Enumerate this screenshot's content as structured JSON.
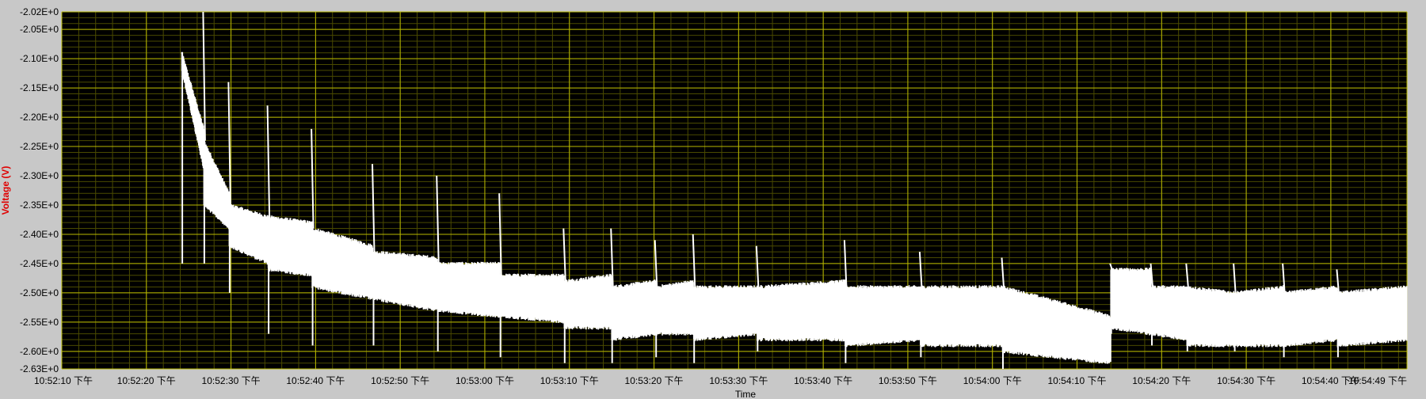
{
  "chart_data": {
    "type": "line",
    "xlabel": "Time",
    "ylabel": "Voltage (V)",
    "ylim": [
      -2.63,
      -2.02
    ],
    "xlim": [
      "10:52:10 下午",
      "10:54:49 下午"
    ],
    "grid": true,
    "background_color": "#000000",
    "grid_color": "#b8b800",
    "minor_grid_color": "#4a4a00",
    "series_color": "#ffffff",
    "y_ticks": [
      "-2.02E+0",
      "-2.05E+0",
      "-2.10E+0",
      "-2.15E+0",
      "-2.20E+0",
      "-2.25E+0",
      "-2.30E+0",
      "-2.35E+0",
      "-2.40E+0",
      "-2.45E+0",
      "-2.50E+0",
      "-2.55E+0",
      "-2.60E+0",
      "-2.63E+0"
    ],
    "y_tick_values": [
      -2.02,
      -2.05,
      -2.1,
      -2.15,
      -2.2,
      -2.25,
      -2.3,
      -2.35,
      -2.4,
      -2.45,
      -2.5,
      -2.55,
      -2.6,
      -2.63
    ],
    "x_ticks": [
      "10:52:10 下午",
      "10:52:20 下午",
      "10:52:30 下午",
      "10:52:40 下午",
      "10:52:50 下午",
      "10:53:00 下午",
      "10:53:10 下午",
      "10:53:20 下午",
      "10:53:30 下午",
      "10:53:40 下午",
      "10:53:50 下午",
      "10:54:00 下午",
      "10:54:10 下午",
      "10:54:20 下午",
      "10:54:30 下午",
      "10:54:40 下午",
      "10:54:49 下午"
    ],
    "x_tick_seconds": [
      0,
      10,
      20,
      30,
      40,
      50,
      60,
      70,
      80,
      90,
      100,
      110,
      120,
      130,
      140,
      150,
      159
    ],
    "series": [
      {
        "segments": [
          {
            "t": [
              14.2,
              16.8
            ],
            "low_start": -2.12,
            "low_end": -2.29,
            "high_start": -2.09,
            "high_end": -2.22,
            "spike_low": -2.45
          },
          {
            "t": [
              16.8,
              19.8
            ],
            "low_start": -2.35,
            "low_end": -2.39,
            "high_start": -2.24,
            "high_end": -2.33,
            "spike_high": -2.02,
            "spike_low": -2.45
          },
          {
            "t": [
              19.8,
              24.4
            ],
            "low_start": -2.42,
            "low_end": -2.45,
            "high_start": -2.35,
            "high_end": -2.37,
            "spike_high": -2.14,
            "spike_low": -2.5
          },
          {
            "t": [
              24.4,
              29.6
            ],
            "low_start": -2.46,
            "low_end": -2.47,
            "high_start": -2.37,
            "high_end": -2.38,
            "spike_high": -2.18,
            "spike_low": -2.57
          },
          {
            "t": [
              29.6,
              36.8
            ],
            "low_start": -2.49,
            "low_end": -2.51,
            "high_start": -2.39,
            "high_end": -2.42,
            "spike_high": -2.22,
            "spike_low": -2.59
          },
          {
            "t": [
              36.8,
              44.4
            ],
            "low_start": -2.51,
            "low_end": -2.53,
            "high_start": -2.43,
            "high_end": -2.44,
            "spike_high": -2.28,
            "spike_low": -2.59
          },
          {
            "t": [
              44.4,
              51.8
            ],
            "low_start": -2.53,
            "low_end": -2.54,
            "high_start": -2.45,
            "high_end": -2.45,
            "spike_high": -2.3,
            "spike_low": -2.6
          },
          {
            "t": [
              51.8,
              59.4
            ],
            "low_start": -2.54,
            "low_end": -2.55,
            "high_start": -2.47,
            "high_end": -2.47,
            "spike_high": -2.33,
            "spike_low": -2.61
          },
          {
            "t": [
              59.4,
              65.0
            ],
            "low_start": -2.56,
            "low_end": -2.56,
            "high_start": -2.48,
            "high_end": -2.47,
            "spike_high": -2.39,
            "spike_low": -2.62
          },
          {
            "t": [
              65.0,
              70.2
            ],
            "low_start": -2.58,
            "low_end": -2.57,
            "high_start": -2.49,
            "high_end": -2.48,
            "spike_high": -2.39,
            "spike_low": -2.62
          },
          {
            "t": [
              70.2,
              74.7
            ],
            "low_start": -2.57,
            "low_end": -2.57,
            "high_start": -2.49,
            "high_end": -2.48,
            "spike_high": -2.41,
            "spike_low": -2.61
          },
          {
            "t": [
              74.7,
              82.2
            ],
            "low_start": -2.58,
            "low_end": -2.57,
            "high_start": -2.49,
            "high_end": -2.49,
            "spike_high": -2.4,
            "spike_low": -2.62
          },
          {
            "t": [
              82.2,
              92.6
            ],
            "low_start": -2.58,
            "low_end": -2.58,
            "high_start": -2.49,
            "high_end": -2.48,
            "spike_high": -2.42,
            "spike_low": -2.6
          },
          {
            "t": [
              92.6,
              101.5
            ],
            "low_start": -2.59,
            "low_end": -2.58,
            "high_start": -2.49,
            "high_end": -2.49,
            "spike_high": -2.41,
            "spike_low": -2.62
          },
          {
            "t": [
              101.5,
              111.2
            ],
            "low_start": -2.59,
            "low_end": -2.59,
            "high_start": -2.49,
            "high_end": -2.49,
            "spike_high": -2.43,
            "spike_low": -2.61
          },
          {
            "t": [
              111.2,
              124.0
            ],
            "low_start": -2.6,
            "low_end": -2.62,
            "high_start": -2.49,
            "high_end": -2.54,
            "spike_high": -2.44,
            "spike_low": -2.63
          },
          {
            "t": [
              124.0,
              128.8
            ],
            "low_start": -2.56,
            "low_end": -2.57,
            "high_start": -2.46,
            "high_end": -2.46,
            "spike_high": -2.45,
            "spike_low": -2.57
          },
          {
            "t": [
              128.8,
              133.0
            ],
            "low_start": -2.57,
            "low_end": -2.58,
            "high_start": -2.49,
            "high_end": -2.49,
            "spike_high": -2.45,
            "spike_low": -2.59
          },
          {
            "t": [
              133.0,
              138.6
            ],
            "low_start": -2.59,
            "low_end": -2.59,
            "high_start": -2.49,
            "high_end": -2.5,
            "spike_high": -2.45,
            "spike_low": -2.6
          },
          {
            "t": [
              138.6,
              144.4
            ],
            "low_start": -2.59,
            "low_end": -2.59,
            "high_start": -2.5,
            "high_end": -2.49,
            "spike_high": -2.45,
            "spike_low": -2.6
          },
          {
            "t": [
              144.4,
              150.8
            ],
            "low_start": -2.59,
            "low_end": -2.58,
            "high_start": -2.5,
            "high_end": -2.49,
            "spike_high": -2.45,
            "spike_low": -2.61
          },
          {
            "t": [
              150.8,
              159.0
            ],
            "low_start": -2.59,
            "low_end": -2.58,
            "high_start": -2.5,
            "high_end": -2.49,
            "spike_high": -2.46,
            "spike_low": -2.61
          }
        ]
      }
    ]
  }
}
